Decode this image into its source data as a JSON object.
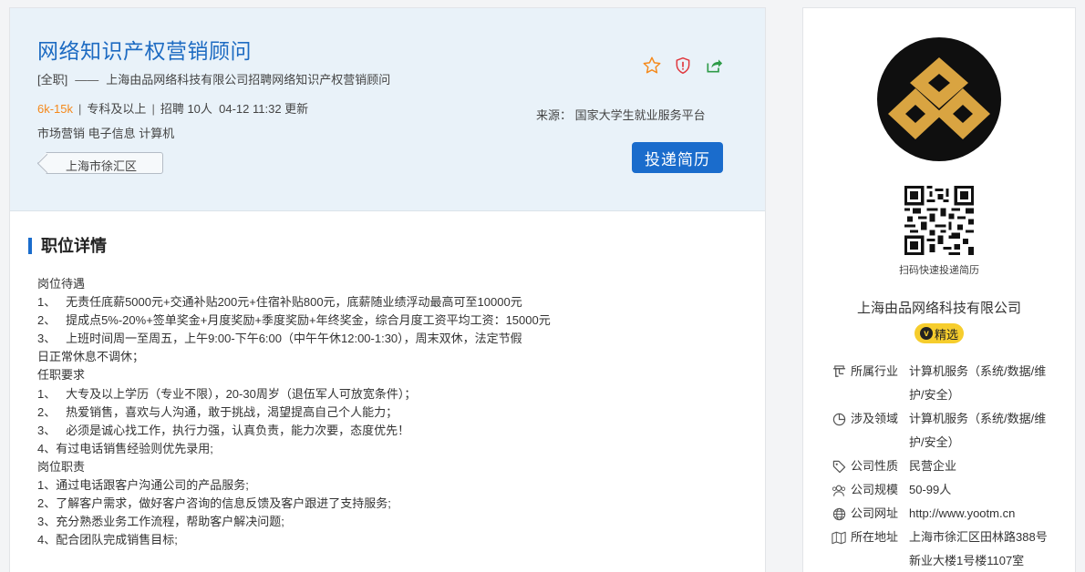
{
  "job": {
    "title": "网络知识产权营销顾问",
    "type": "[全职]",
    "dash": "——",
    "headline": "上海由品网络科技有限公司招聘网络知识产权营销顾问",
    "salary": "6k-15k",
    "sep": "|",
    "education": "专科及以上",
    "recruit": "招聘 10人",
    "updated": "04-12 11:32 更新",
    "tags": "市场营销 电子信息 计算机",
    "location": "上海市徐汇区",
    "source": "来源： 国家大学生就业服务平台",
    "apply_label": "投递简历"
  },
  "icons": {
    "favorite": "star-icon",
    "report": "shield-alert-icon",
    "share": "share-icon"
  },
  "section": {
    "title": "职位详情"
  },
  "description": [
    "岗位待遇",
    "1、   无责任底薪5000元+交通补贴200元+住宿补贴800元，底薪随业绩浮动最高可至10000元",
    "2、   提成点5%-20%+签单奖金+月度奖励+季度奖励+年终奖金，综合月度工资平均工资：15000元",
    "3、   上班时间周一至周五，上午9:00-下午6:00（中午午休12:00-1:30），周末双休，法定节假",
    "日正常休息不调休；",
    "任职要求",
    "1、   大专及以上学历（专业不限），20-30周岁（退伍军人可放宽条件）；",
    "2、   热爱销售，喜欢与人沟通，敢于挑战，渴望提高自己个人能力；",
    "3、   必须是诚心找工作，执行力强，认真负责，能力次要，态度优先！",
    "4、有过电话销售经验则优先录用;",
    "岗位职责",
    "1、通过电话跟客户沟通公司的产品服务;",
    "2、了解客户需求，做好客户咨询的信息反馈及客户跟进了支持服务;",
    "3、充分熟悉业务工作流程，帮助客户解决问题;",
    "4、配合团队完成销售目标;"
  ],
  "company": {
    "qr_caption": "扫码快速投递简历",
    "name": "上海由品网络科技有限公司",
    "badge": "精选",
    "badge_letter": "v",
    "info": [
      {
        "icon": "industry-icon",
        "label": "所属行业",
        "value": "计算机服务（系统/数据/维护/安全）"
      },
      {
        "icon": "pie-chart-icon",
        "label": "涉及领域",
        "value": "计算机服务（系统/数据/维护/安全）"
      },
      {
        "icon": "tag-icon",
        "label": "公司性质",
        "value": "民营企业"
      },
      {
        "icon": "people-icon",
        "label": "公司规模",
        "value": "50-99人"
      },
      {
        "icon": "globe-icon",
        "label": "公司网址",
        "value": "http://www.yootm.cn"
      },
      {
        "icon": "map-icon",
        "label": "所在地址",
        "value": "上海市徐汇区田林路388号新业大楼1号楼1107室"
      }
    ]
  },
  "colors": {
    "accent": "#1a6ccc",
    "title_blue": "#1d6bc2",
    "salary_orange": "#f5891b",
    "header_bg": "#e9f2f9",
    "logo_gold": "#d9a441",
    "badge_yellow": "#f6cd2d"
  }
}
